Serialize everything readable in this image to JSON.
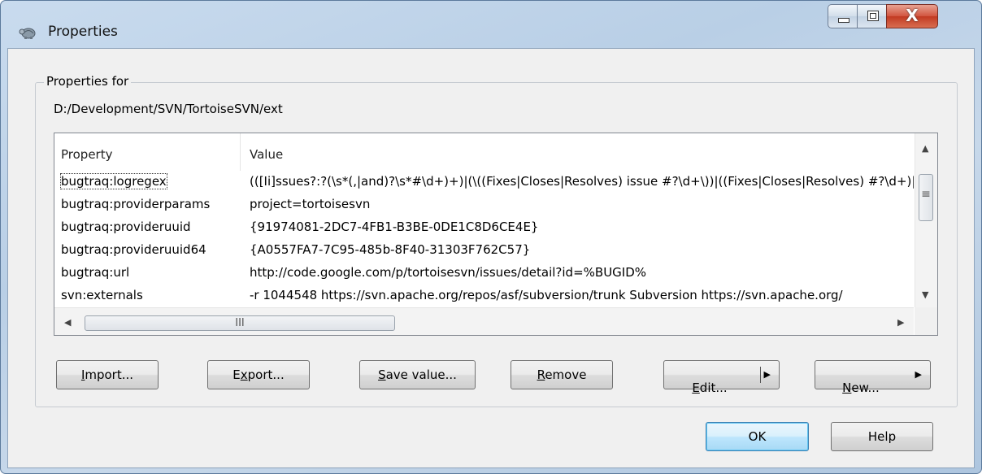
{
  "window": {
    "title": "Properties",
    "icon": "tortoise-app-icon",
    "controls": {
      "minimize": "minimize-icon",
      "maximize": "maximize-icon",
      "close_label": "X"
    }
  },
  "group": {
    "legend": "Properties for",
    "path": "D:/Development/SVN/TortoiseSVN/ext"
  },
  "table": {
    "columns": [
      "Property",
      "Value"
    ],
    "rows": [
      {
        "property": "bugtraq:logregex",
        "value": "(([Ii]ssues?:?(\\s*(,|and)?\\s*#\\d+)+)|(\\((Fixes|Closes|Resolves) issue #?\\d+\\))|((Fixes|Closes|Resolves) #?\\d+)|"
      },
      {
        "property": "bugtraq:providerparams",
        "value": "project=tortoisesvn"
      },
      {
        "property": "bugtraq:provideruuid",
        "value": "{91974081-2DC7-4FB1-B3BE-0DE1C8D6CE4E}"
      },
      {
        "property": "bugtraq:provideruuid64",
        "value": "{A0557FA7-7C95-485b-8F40-31303F762C57}"
      },
      {
        "property": "bugtraq:url",
        "value": "http://code.google.com/p/tortoisesvn/issues/detail?id=%BUGID%"
      },
      {
        "property": "svn:externals",
        "value": "-r 1044548 https://svn.apache.org/repos/asf/subversion/trunk Subversion https://svn.apache.org/"
      }
    ],
    "scroll": {
      "grip": "≡",
      "hgrip": "III",
      "up": "▲",
      "down": "▼",
      "left": "◀",
      "right": "▶"
    }
  },
  "buttons": {
    "import": {
      "accel": "I",
      "rest": "mport..."
    },
    "export": {
      "pre": "E",
      "accel": "x",
      "rest": "port..."
    },
    "save_value": {
      "accel": "S",
      "rest": "ave value..."
    },
    "remove": {
      "accel": "R",
      "rest": "emove"
    },
    "edit": {
      "accel": "E",
      "rest": "dit...",
      "arrow": "▶"
    },
    "new": {
      "accel": "N",
      "rest": "ew...",
      "arrow": "▶"
    },
    "ok": "OK",
    "help": "Help"
  }
}
